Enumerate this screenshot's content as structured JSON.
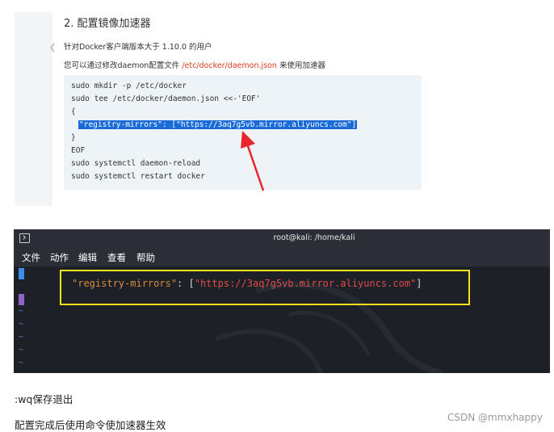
{
  "doc": {
    "heading": "2. 配置镜像加速器",
    "intro": "针对Docker客户端版本大于 1.10.0 的用户",
    "instruction_prefix": "您可以通过修改daemon配置文件 ",
    "instruction_path": "/etc/docker/daemon.json",
    "instruction_suffix": " 来使用加速器",
    "chevron_icon": "chevron-left-icon",
    "code": [
      "sudo mkdir -p /etc/docker",
      "sudo tee /etc/docker/daemon.json <<-'EOF'",
      "{",
      "\"registry-mirrors\": [\"https://3aq7g5vb.mirror.aliyuncs.com\"]",
      "}",
      "EOF",
      "sudo systemctl daemon-reload",
      "sudo systemctl restart docker"
    ],
    "highlight_color": "#1b6bd6",
    "arrow_color": "#e8262b"
  },
  "terminal": {
    "title": "root@kali: /home/kali",
    "menu": [
      "文件",
      "动作",
      "编辑",
      "查看",
      "帮助"
    ],
    "line_key": "\"registry-mirrors\"",
    "line_colon": ": [",
    "line_url": "\"https://3aq7g5vb.mirror.aliyuncs.com\"",
    "line_close": "]",
    "tildes": [
      "~",
      "~",
      "~",
      "~",
      "~"
    ],
    "box_color": "#f2e318"
  },
  "footer": {
    "save_text": ":wq保存退出",
    "after_text": "配置完成后使用命令使加速器生效",
    "watermark": "CSDN @mmxhappy"
  }
}
